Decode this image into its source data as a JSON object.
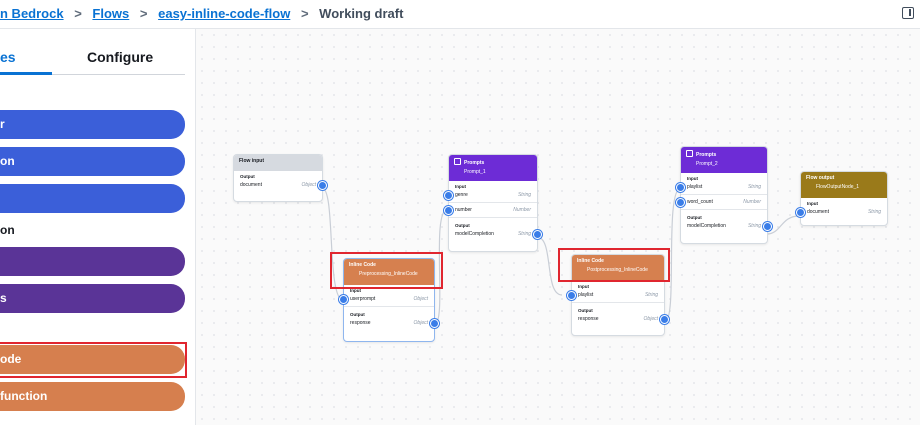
{
  "breadcrumb": {
    "items": [
      "n Bedrock",
      "Flows",
      "easy-inline-code-flow"
    ],
    "current": "Working draft",
    "separator": ">"
  },
  "sidebar": {
    "tabs": [
      {
        "label": "es",
        "active": true
      },
      {
        "label": "Configure",
        "active": false
      }
    ],
    "groups": [
      {
        "label": "",
        "items": [
          "r",
          "on",
          ""
        ]
      },
      {
        "label": "on",
        "items": [
          "",
          "s"
        ]
      },
      {
        "label": "",
        "items": [
          "ode",
          " function"
        ]
      }
    ]
  },
  "colors": {
    "accent": "#0972d3",
    "node_blue": "#3b5fd9",
    "node_purple": "#5a3497",
    "node_orange": "#d67f4e",
    "highlight": "#e0262f",
    "port": "#3a7de8"
  },
  "nodes": {
    "flow_input": {
      "title": "Flow input",
      "output_label": "Output",
      "rows": [
        {
          "name": "document",
          "type": "Object"
        }
      ]
    },
    "prompt1": {
      "title": "Prompts",
      "subtitle": "Prompt_1",
      "input_label": "Input",
      "inputs": [
        {
          "name": "genre",
          "type": "String"
        },
        {
          "name": "number",
          "type": "Number"
        }
      ],
      "output_label": "Output",
      "outputs": [
        {
          "name": "modelCompletion",
          "type": "String"
        }
      ]
    },
    "code1": {
      "title": "Inline Code",
      "subtitle": "Preprocessing_InlineCode",
      "input_label": "Input",
      "inputs": [
        {
          "name": "userprompt",
          "type": "Object"
        }
      ],
      "output_label": "Output",
      "outputs": [
        {
          "name": "response",
          "type": "Object"
        }
      ]
    },
    "code2": {
      "title": "Inline Code",
      "subtitle": "Postprocessing_InlineCode",
      "input_label": "Input",
      "inputs": [
        {
          "name": "playlist",
          "type": "String"
        }
      ],
      "output_label": "Output",
      "outputs": [
        {
          "name": "response",
          "type": "Object"
        }
      ]
    },
    "prompt2": {
      "title": "Prompts",
      "subtitle": "Prompt_2",
      "input_label": "Input",
      "inputs": [
        {
          "name": "playlist",
          "type": "String"
        },
        {
          "name": "word_count",
          "type": "Number"
        }
      ],
      "output_label": "Output",
      "outputs": [
        {
          "name": "modelCompletion",
          "type": "String"
        }
      ]
    },
    "flow_output": {
      "title": "Flow output",
      "subtitle": "FlowOutputNode_1",
      "input_label": "Input",
      "inputs": [
        {
          "name": "document",
          "type": "String"
        }
      ]
    }
  }
}
